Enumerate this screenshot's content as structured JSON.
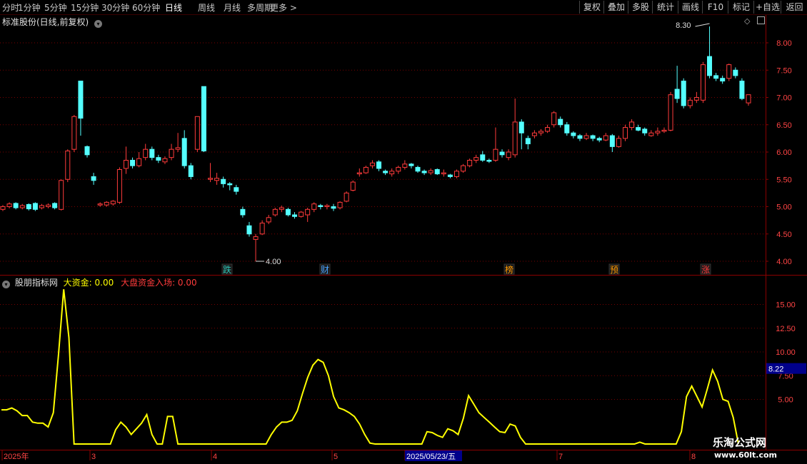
{
  "toolbar": {
    "timeframes": [
      "分时",
      "1分钟",
      "5分钟",
      "15分钟",
      "30分钟",
      "60分钟",
      "日线",
      "周线",
      "月线",
      "多周期",
      "更多 >"
    ],
    "active_timeframe": "日线",
    "buttons": [
      "复权",
      "叠加",
      "多股",
      "统计",
      "画线",
      "F10",
      "标记",
      "+自选",
      "返回"
    ]
  },
  "main_panel": {
    "title": "标准股份(日线,前复权)",
    "high_label": "8.30",
    "low_label": "4.00",
    "price_axis": [
      "8.00",
      "7.50",
      "7.00",
      "6.50",
      "6.00",
      "5.50",
      "5.00",
      "4.50",
      "4.00"
    ],
    "event_tags": [
      {
        "text": "跌",
        "color": "#2ec4b6"
      },
      {
        "text": "财",
        "color": "#4aa3ff"
      },
      {
        "text": "榜",
        "color": "#ff9900"
      },
      {
        "text": "预",
        "color": "#ff9900"
      },
      {
        "text": "涨",
        "color": "#ff3b3b"
      }
    ],
    "candles": [
      [
        4.95,
        5.0,
        4.92,
        5.03
      ],
      [
        5.0,
        5.05,
        4.97,
        5.08
      ],
      [
        5.06,
        4.98,
        4.95,
        5.08
      ],
      [
        4.98,
        5.02,
        4.95,
        5.05
      ],
      [
        5.04,
        4.96,
        4.93,
        5.06
      ],
      [
        5.06,
        4.95,
        4.92,
        5.08
      ],
      [
        4.98,
        5.02,
        4.95,
        5.05
      ],
      [
        5.0,
        5.03,
        4.97,
        5.06
      ],
      [
        5.06,
        4.98,
        4.95,
        5.08
      ],
      [
        4.95,
        5.48,
        4.93,
        5.5
      ],
      [
        5.5,
        6.02,
        5.45,
        6.05
      ],
      [
        6.05,
        6.65,
        6.0,
        6.68
      ],
      [
        7.3,
        6.62,
        6.3,
        7.3
      ],
      [
        6.1,
        5.95,
        5.9,
        6.12
      ],
      [
        5.55,
        5.48,
        5.4,
        5.62
      ],
      [
        5.03,
        5.05,
        5.0,
        5.08
      ],
      [
        5.03,
        5.08,
        5.0,
        5.1
      ],
      [
        5.05,
        5.1,
        5.02,
        5.12
      ],
      [
        5.08,
        5.68,
        5.05,
        5.72
      ],
      [
        5.7,
        5.85,
        5.6,
        6.1
      ],
      [
        5.85,
        5.75,
        5.7,
        5.9
      ],
      [
        5.75,
        5.88,
        5.72,
        6.0
      ],
      [
        5.9,
        6.05,
        5.85,
        6.15
      ],
      [
        6.05,
        5.9,
        5.85,
        6.1
      ],
      [
        5.9,
        5.85,
        5.8,
        5.95
      ],
      [
        5.82,
        5.88,
        5.78,
        5.92
      ],
      [
        5.9,
        6.05,
        5.85,
        6.15
      ],
      [
        6.05,
        6.08,
        6.0,
        6.35
      ],
      [
        6.25,
        5.75,
        5.7,
        6.4
      ],
      [
        5.75,
        5.55,
        5.5,
        5.8
      ],
      [
        6.05,
        6.65,
        6.0,
        6.65
      ],
      [
        7.2,
        6.02,
        6.0,
        7.2
      ],
      [
        5.5,
        5.52,
        5.45,
        5.8
      ],
      [
        5.48,
        5.52,
        5.4,
        5.62
      ],
      [
        5.5,
        5.42,
        5.35,
        5.55
      ],
      [
        5.42,
        5.4,
        5.3,
        5.45
      ],
      [
        5.35,
        5.28,
        5.22,
        5.4
      ],
      [
        4.95,
        4.85,
        4.8,
        5.0
      ],
      [
        4.65,
        4.5,
        4.45,
        4.72
      ],
      [
        4.4,
        4.45,
        4.0,
        4.5
      ],
      [
        4.5,
        4.7,
        4.48,
        4.75
      ],
      [
        4.72,
        4.8,
        4.68,
        4.85
      ],
      [
        4.85,
        4.95,
        4.82,
        4.98
      ],
      [
        4.95,
        4.98,
        4.9,
        5.02
      ],
      [
        4.95,
        4.85,
        4.82,
        4.98
      ],
      [
        4.85,
        4.82,
        4.78,
        4.9
      ],
      [
        4.82,
        4.9,
        4.8,
        4.92
      ],
      [
        4.85,
        4.95,
        4.72,
        4.98
      ],
      [
        4.95,
        5.05,
        4.9,
        5.08
      ],
      [
        5.02,
        5.0,
        4.95,
        5.05
      ],
      [
        5.0,
        5.02,
        4.95,
        5.05
      ],
      [
        5.0,
        4.97,
        4.92,
        5.05
      ],
      [
        4.98,
        5.08,
        4.95,
        5.1
      ],
      [
        5.1,
        5.25,
        5.08,
        5.28
      ],
      [
        5.3,
        5.45,
        5.28,
        5.48
      ],
      [
        5.6,
        5.62,
        5.55,
        5.7
      ],
      [
        5.62,
        5.72,
        5.6,
        5.75
      ],
      [
        5.75,
        5.8,
        5.7,
        5.85
      ],
      [
        5.82,
        5.7,
        5.65,
        5.85
      ],
      [
        5.65,
        5.62,
        5.58,
        5.68
      ],
      [
        5.6,
        5.65,
        5.55,
        5.7
      ],
      [
        5.65,
        5.72,
        5.6,
        5.75
      ],
      [
        5.72,
        5.78,
        5.68,
        5.85
      ],
      [
        5.78,
        5.75,
        5.7,
        5.8
      ],
      [
        5.72,
        5.65,
        5.62,
        5.75
      ],
      [
        5.65,
        5.62,
        5.58,
        5.68
      ],
      [
        5.62,
        5.66,
        5.58,
        5.7
      ],
      [
        5.68,
        5.6,
        5.58,
        5.7
      ],
      [
        5.6,
        5.62,
        5.55,
        5.68
      ],
      [
        5.58,
        5.55,
        5.52,
        5.6
      ],
      [
        5.55,
        5.65,
        5.52,
        5.68
      ],
      [
        5.65,
        5.75,
        5.62,
        5.78
      ],
      [
        5.75,
        5.85,
        5.72,
        5.88
      ],
      [
        5.85,
        5.9,
        5.8,
        5.95
      ],
      [
        5.95,
        5.85,
        5.82,
        6.02
      ],
      [
        5.85,
        5.83,
        5.8,
        5.88
      ],
      [
        5.85,
        6.05,
        5.82,
        6.45
      ],
      [
        6.0,
        5.95,
        5.9,
        6.05
      ],
      [
        5.9,
        6.0,
        5.85,
        6.05
      ],
      [
        5.95,
        6.55,
        5.9,
        6.98
      ],
      [
        6.55,
        6.35,
        6.05,
        6.6
      ],
      [
        6.25,
        6.15,
        6.05,
        6.3
      ],
      [
        6.3,
        6.35,
        6.25,
        6.4
      ],
      [
        6.35,
        6.38,
        6.3,
        6.42
      ],
      [
        6.38,
        6.45,
        6.35,
        6.5
      ],
      [
        6.5,
        6.72,
        6.45,
        6.75
      ],
      [
        6.6,
        6.5,
        6.45,
        6.65
      ],
      [
        6.5,
        6.35,
        6.3,
        6.55
      ],
      [
        6.35,
        6.3,
        6.25,
        6.38
      ],
      [
        6.3,
        6.25,
        6.2,
        6.33
      ],
      [
        6.25,
        6.3,
        6.22,
        6.35
      ],
      [
        6.3,
        6.25,
        6.2,
        6.32
      ],
      [
        6.25,
        6.22,
        6.18,
        6.28
      ],
      [
        6.22,
        6.3,
        6.2,
        6.35
      ],
      [
        6.3,
        6.1,
        6.0,
        6.33
      ],
      [
        6.1,
        6.25,
        6.08,
        6.3
      ],
      [
        6.25,
        6.45,
        6.2,
        6.5
      ],
      [
        6.45,
        6.55,
        6.4,
        6.6
      ],
      [
        6.45,
        6.4,
        6.38,
        6.5
      ],
      [
        6.42,
        6.35,
        6.3,
        6.45
      ],
      [
        6.3,
        6.35,
        6.28,
        6.4
      ],
      [
        6.35,
        6.38,
        6.3,
        6.45
      ],
      [
        6.38,
        6.4,
        6.35,
        6.45
      ],
      [
        6.4,
        7.05,
        6.38,
        7.1
      ],
      [
        7.15,
        6.98,
        6.9,
        7.58
      ],
      [
        7.3,
        6.85,
        6.8,
        7.35
      ],
      [
        6.85,
        6.95,
        6.8,
        7.0
      ],
      [
        6.95,
        7.0,
        6.9,
        7.1
      ],
      [
        6.95,
        7.6,
        6.9,
        7.65
      ],
      [
        7.75,
        7.4,
        7.35,
        8.3
      ],
      [
        7.4,
        7.35,
        7.3,
        7.45
      ],
      [
        7.35,
        7.3,
        7.25,
        7.4
      ],
      [
        7.35,
        7.6,
        7.3,
        7.62
      ],
      [
        7.5,
        7.4,
        7.35,
        7.55
      ],
      [
        7.3,
        6.98,
        6.95,
        7.35
      ],
      [
        6.9,
        7.05,
        6.85,
        7.05
      ]
    ]
  },
  "indicator_panel": {
    "name": "股朋指标网",
    "label1": "大资金: 0.00",
    "label2": "大盘资金入场: 0.00",
    "axis": [
      "15.00",
      "12.50",
      "10.00",
      "7.50",
      "5.00"
    ],
    "current_value": "8.22",
    "series": [
      3.9,
      3.9,
      4.1,
      3.8,
      3.3,
      3.3,
      2.6,
      2.5,
      2.5,
      2.1,
      3.6,
      9.7,
      16.6,
      11.5,
      0.3,
      0.3,
      0.3,
      0.3,
      0.3,
      0.3,
      0.3,
      0.3,
      1.8,
      2.6,
      2.1,
      1.3,
      1.9,
      2.5,
      3.4,
      1.3,
      0.3,
      0.3,
      3.2,
      3.2,
      0.3,
      0.3,
      0.3,
      0.3,
      0.3,
      0.3,
      0.3,
      0.3,
      0.3,
      0.3,
      0.3,
      0.3,
      0.3,
      0.3,
      0.3,
      0.3,
      0.3,
      0.3,
      1.3,
      2.1,
      2.6,
      2.6,
      2.8,
      3.8,
      5.6,
      7.3,
      8.6,
      9.2,
      8.9,
      7.5,
      5.3,
      4.1,
      3.9,
      3.6,
      3.2,
      2.4,
      1.3,
      0.4,
      0.3,
      0.3,
      0.3,
      0.3,
      0.3,
      0.3,
      0.3,
      0.3,
      0.3,
      0.3,
      1.6,
      1.5,
      1.2,
      1.0,
      1.9,
      1.7,
      1.3,
      3.0,
      5.4,
      4.5,
      3.6,
      3.1,
      2.6,
      2.1,
      1.6,
      1.5,
      2.4,
      2.2,
      1.0,
      0.3,
      0.3,
      0.3,
      0.3,
      0.3,
      0.3,
      0.3,
      0.3,
      0.3,
      0.3,
      0.3,
      0.3,
      0.3,
      0.3,
      0.3,
      0.3,
      0.3,
      0.3,
      0.3,
      0.3,
      0.3,
      0.3,
      0.5,
      0.3,
      0.3,
      0.3,
      0.3,
      0.3,
      0.3,
      0.3,
      1.6,
      5.3,
      6.4,
      5.3,
      4.2,
      6.1,
      8.1,
      6.9,
      5.0,
      4.8,
      3.1,
      0.3
    ]
  },
  "time_axis": {
    "labels": [
      "2025年",
      "3",
      "4",
      "5",
      "2025/05/23/五",
      "7",
      "8"
    ]
  },
  "watermark": {
    "line1": "乐淘公式网",
    "line2": "www.60lt.com"
  },
  "colors": {
    "up": "#ff3b3b",
    "down": "#54ffff",
    "grid": "#7a0000",
    "axis_text": "#ff4444",
    "indicator_line": "#ffff00",
    "cursor_box": "#00008b"
  }
}
